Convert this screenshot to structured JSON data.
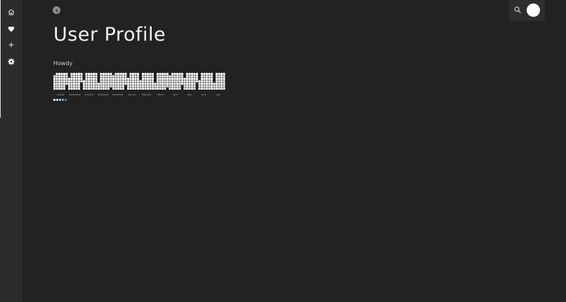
{
  "page": {
    "title": "User Profile",
    "greeting": "Howdy"
  },
  "sidebar": {
    "items": [
      {
        "name": "home",
        "icon": "home-icon"
      },
      {
        "name": "favorites",
        "icon": "heart-icon"
      },
      {
        "name": "add",
        "icon": "plus-icon"
      },
      {
        "name": "settings",
        "icon": "gear-icon"
      }
    ]
  },
  "header": {
    "back_icon": "chevron-left-icon",
    "search_icon": "search-icon"
  },
  "activity": {
    "months": [
      "August",
      "September",
      "October",
      "November",
      "December",
      "January",
      "February",
      "March",
      "April",
      "May",
      "June",
      "July"
    ],
    "cell_color": "#ffffff",
    "legend_colors": [
      "#e8e8e8",
      "#c6d6e6",
      "#9fbcd9",
      "#6f9cc6",
      "#3f7bb0"
    ]
  }
}
